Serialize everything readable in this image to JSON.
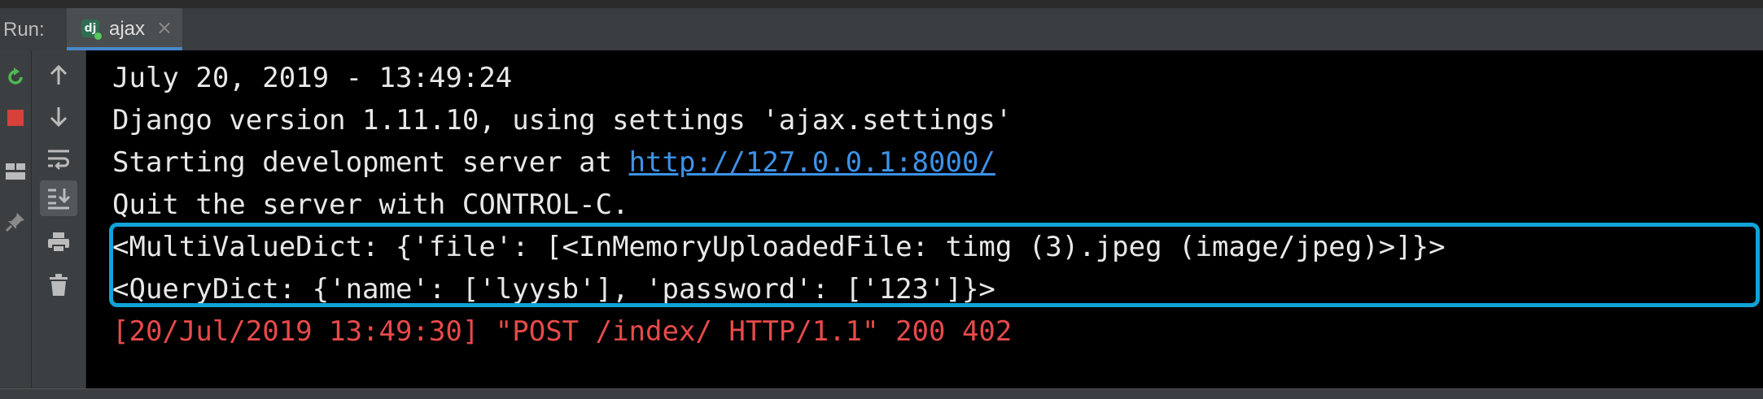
{
  "run_panel": {
    "label": "Run:",
    "tab": {
      "label": "ajax",
      "icon_text": "dj",
      "close_glyph": "×"
    }
  },
  "left_toolbar": [
    {
      "name": "rerun-icon",
      "color": "#4fb84f"
    },
    {
      "name": "stop-icon",
      "color": "#d9403a"
    },
    {
      "name": "layout-icon",
      "color": "#bbbbbb"
    },
    {
      "name": "pin-icon",
      "color": "#8a8a8a"
    }
  ],
  "console_toolbar": [
    {
      "name": "scroll-up-icon"
    },
    {
      "name": "scroll-down-icon"
    },
    {
      "name": "soft-wrap-icon"
    },
    {
      "name": "scroll-to-end-icon"
    },
    {
      "name": "print-icon"
    },
    {
      "name": "trash-icon"
    }
  ],
  "console": {
    "lines": [
      "July 20, 2019 - 13:49:24",
      "Django version 1.11.10, using settings 'ajax.settings'",
      "Starting development server at ",
      "Quit the server with CONTROL-C.",
      "<MultiValueDict: {'file': [<InMemoryUploadedFile: timg (3).jpeg (image/jpeg)>]}>",
      "<QueryDict: {'name': ['lyysb'], 'password': ['123']}>",
      "[20/Jul/2019 13:49:30] \"POST /index/ HTTP/1.1\" 200 402"
    ],
    "server_url": "http://127.0.0.1:8000/",
    "colors": {
      "normal": "#e8e8e8",
      "link": "#3d92e8",
      "error": "#e84a4a",
      "highlight_border": "#0fa3d8"
    }
  }
}
